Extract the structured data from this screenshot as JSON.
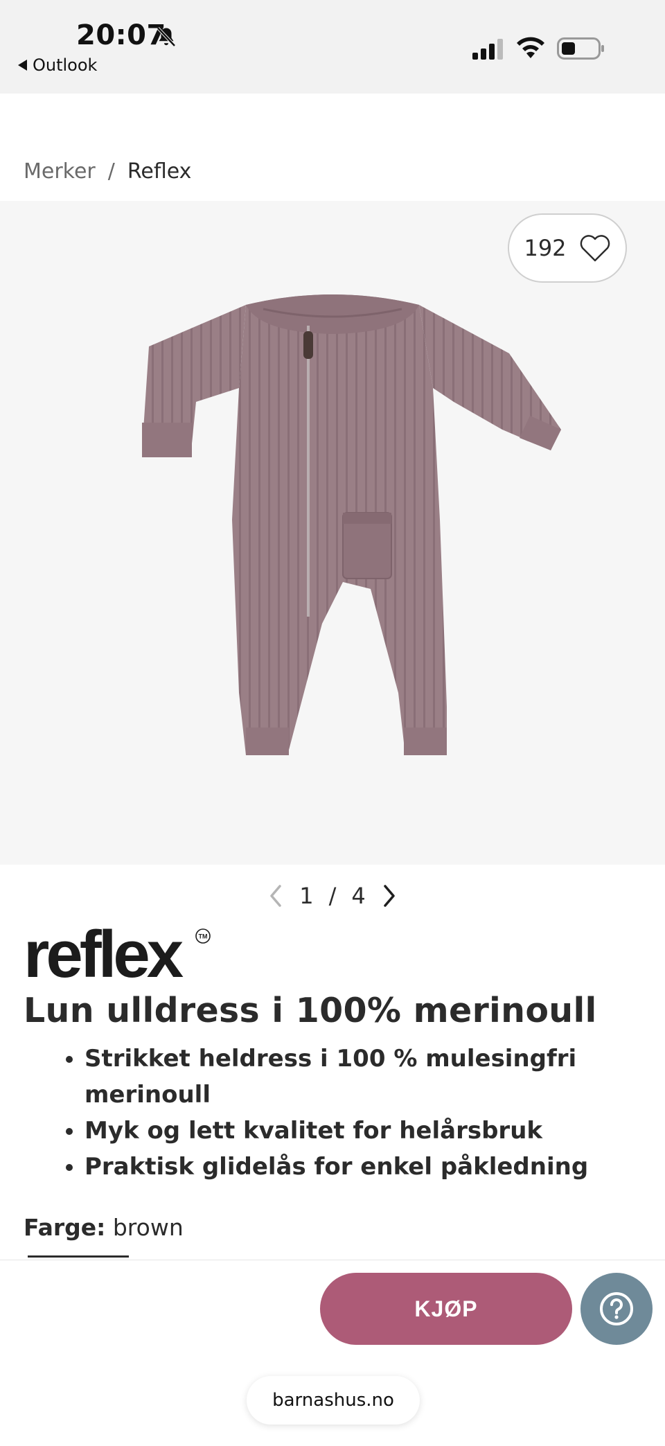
{
  "status_bar": {
    "time": "20:07",
    "back_label": "Outlook",
    "icons": [
      "bell-slash-icon",
      "cellular-signal-icon",
      "wifi-icon",
      "battery-icon"
    ]
  },
  "breadcrumb": {
    "items": [
      "Merker",
      "Reflex"
    ],
    "separator": "/"
  },
  "gallery": {
    "favorites_count": "192",
    "current_index": "1",
    "separator": "/",
    "total": "4",
    "image_subject": "knitted merino wool baby jumpsuit"
  },
  "product": {
    "brand": "reflex",
    "trademark": "TM",
    "title": "Lun ulldress i 100% merinoull",
    "bullets": [
      "Strikket heldress i 100 % mulesingfri merinoull",
      "Myk og lett kvalitet for helårsbruk",
      "Praktisk glidelås for enkel påkledning"
    ],
    "color_label": "Farge:",
    "color_value": "brown"
  },
  "actions": {
    "buy_label": "KJØP",
    "help_icon": "question-circle-icon"
  },
  "browser": {
    "url": "barnashus.no"
  },
  "colors": {
    "accent": "#ad5b77",
    "help": "#6f8a99",
    "product": "#9a7f86"
  }
}
